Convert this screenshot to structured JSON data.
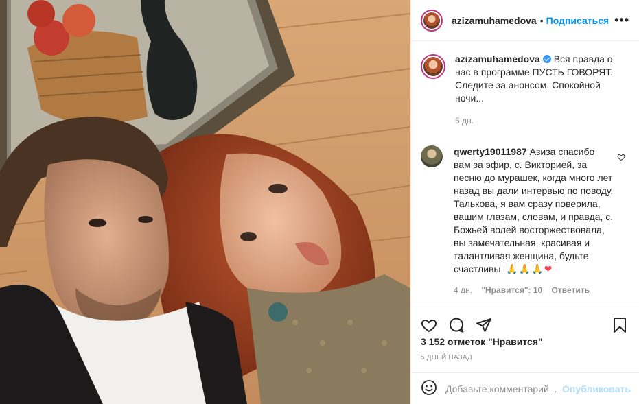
{
  "header": {
    "username": "azizamuhamedova",
    "separator": "•",
    "follow_label": "Подписаться",
    "more_label": "•••"
  },
  "caption": {
    "username": "azizamuhamedova",
    "text": "Вся правда о нас в программе ПУСТЬ ГОВОРЯТ. Следите за анонсом. Спокойной ночи...",
    "time": "5 дн."
  },
  "comment": {
    "username": "qwerty19011987",
    "text": "Азиза спасибо вам за эфир, с. Викторией, за песню до мурашек, когда много лет назад вы дали интервью по поводу. Талькова, я вам сразу поверила, вашим глазам, словам, и правда, с. Божьей волей восторжествовала, вы замечательная, красивая и талантливая женщина, будьте счастливы.",
    "emoji_pray": "🙏🙏🙏",
    "emoji_heart": "❤",
    "time": "4 дн.",
    "likes": "\"Нравится\": 10",
    "reply_label": "Ответить"
  },
  "post": {
    "likes_text": "3 152 отметок \"Нравится\"",
    "posted_ago": "5 ДНЕЙ НАЗАД"
  },
  "add_comment": {
    "placeholder": "Добавьте комментарий...",
    "post_label": "Опубликовать"
  },
  "icons": {
    "like": "heart-outline-icon",
    "comment": "comment-bubble-icon",
    "share": "paper-plane-icon",
    "save": "bookmark-icon",
    "emoji": "smiley-icon",
    "verified": "verified-badge-icon"
  },
  "colors": {
    "link_blue": "#0095f6",
    "post_button_disabled": "#b2dffc",
    "story_ring": "#c13584",
    "secondary_text": "#8e8e8e"
  }
}
